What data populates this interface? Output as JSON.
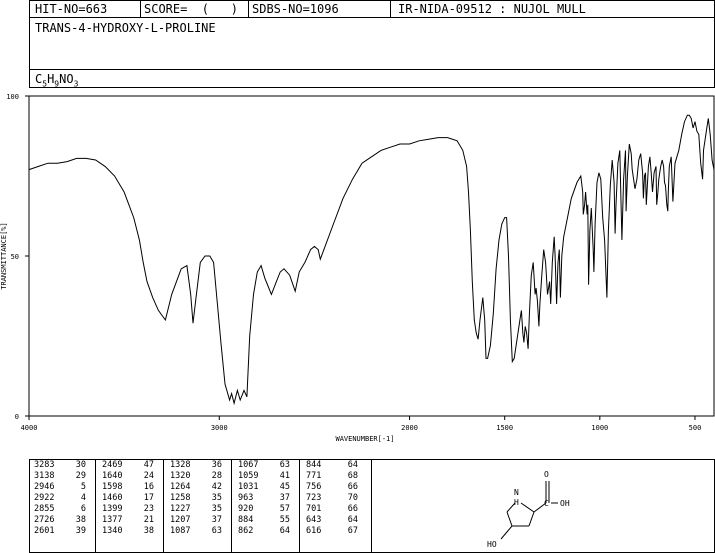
{
  "header": {
    "hit_no": "HIT-NO=663",
    "score": "SCORE=  (   )",
    "sdbs_no": "SDBS-NO=1096",
    "ir_info": "IR-NIDA-09512 : NUJOL MULL",
    "compound_name": "TRANS-4-HYDROXY-L-PROLINE",
    "formula_parts": [
      "C",
      "5",
      "H",
      "9",
      "N",
      "O",
      "3"
    ]
  },
  "chart_data": {
    "type": "line",
    "xlabel": "WAVENUMBER[-1]",
    "ylabel": "TRANSMITTANCE[%]",
    "xlim": [
      4000,
      400
    ],
    "ylim": [
      0,
      100
    ],
    "x_ticks": [
      4000,
      3000,
      2000,
      1500,
      1000,
      500
    ],
    "y_ticks": [
      0,
      50,
      100
    ],
    "x_tick_labels": [
      "4000",
      "3000",
      "2000",
      "1500",
      "1000",
      "500"
    ],
    "y_tick_labels": [
      "0",
      "50",
      "100"
    ],
    "series": [
      {
        "points": [
          [
            4000,
            77
          ],
          [
            3950,
            78
          ],
          [
            3900,
            79
          ],
          [
            3850,
            79
          ],
          [
            3800,
            79.5
          ],
          [
            3750,
            80.5
          ],
          [
            3700,
            80.5
          ],
          [
            3650,
            80
          ],
          [
            3600,
            78
          ],
          [
            3550,
            75
          ],
          [
            3500,
            70
          ],
          [
            3450,
            62
          ],
          [
            3420,
            55
          ],
          [
            3400,
            48
          ],
          [
            3380,
            42
          ],
          [
            3350,
            37
          ],
          [
            3320,
            33
          ],
          [
            3283,
            30
          ],
          [
            3250,
            38
          ],
          [
            3200,
            46
          ],
          [
            3170,
            47
          ],
          [
            3150,
            38
          ],
          [
            3138,
            29
          ],
          [
            3120,
            38
          ],
          [
            3100,
            48
          ],
          [
            3075,
            50
          ],
          [
            3050,
            50
          ],
          [
            3030,
            48
          ],
          [
            3010,
            35
          ],
          [
            2990,
            22
          ],
          [
            2970,
            10
          ],
          [
            2946,
            5
          ],
          [
            2935,
            7
          ],
          [
            2922,
            4
          ],
          [
            2905,
            8
          ],
          [
            2890,
            5
          ],
          [
            2870,
            8
          ],
          [
            2855,
            6
          ],
          [
            2840,
            25
          ],
          [
            2820,
            38
          ],
          [
            2800,
            45
          ],
          [
            2780,
            47
          ],
          [
            2760,
            43
          ],
          [
            2740,
            40
          ],
          [
            2726,
            38
          ],
          [
            2700,
            42
          ],
          [
            2680,
            45
          ],
          [
            2660,
            46
          ],
          [
            2630,
            44
          ],
          [
            2601,
            39
          ],
          [
            2580,
            45
          ],
          [
            2550,
            48
          ],
          [
            2520,
            52
          ],
          [
            2500,
            53
          ],
          [
            2480,
            52
          ],
          [
            2469,
            49
          ],
          [
            2450,
            52
          ],
          [
            2400,
            60
          ],
          [
            2350,
            68
          ],
          [
            2300,
            74
          ],
          [
            2250,
            79
          ],
          [
            2200,
            81
          ],
          [
            2150,
            83
          ],
          [
            2100,
            84
          ],
          [
            2050,
            85
          ],
          [
            2000,
            85
          ],
          [
            1950,
            86
          ],
          [
            1900,
            86.5
          ],
          [
            1850,
            87
          ],
          [
            1800,
            87
          ],
          [
            1750,
            86
          ],
          [
            1720,
            83
          ],
          [
            1700,
            78
          ],
          [
            1690,
            70
          ],
          [
            1680,
            58
          ],
          [
            1670,
            42
          ],
          [
            1660,
            30
          ],
          [
            1650,
            26
          ],
          [
            1640,
            24
          ],
          [
            1630,
            30
          ],
          [
            1615,
            37
          ],
          [
            1605,
            30
          ],
          [
            1598,
            18
          ],
          [
            1590,
            18
          ],
          [
            1575,
            22
          ],
          [
            1560,
            32
          ],
          [
            1545,
            46
          ],
          [
            1530,
            55
          ],
          [
            1515,
            60
          ],
          [
            1500,
            62
          ],
          [
            1490,
            62
          ],
          [
            1480,
            50
          ],
          [
            1470,
            30
          ],
          [
            1460,
            17
          ],
          [
            1450,
            18
          ],
          [
            1440,
            22
          ],
          [
            1420,
            30
          ],
          [
            1412,
            33
          ],
          [
            1405,
            26
          ],
          [
            1399,
            23
          ],
          [
            1392,
            28
          ],
          [
            1385,
            26
          ],
          [
            1377,
            21
          ],
          [
            1370,
            32
          ],
          [
            1360,
            44
          ],
          [
            1350,
            48
          ],
          [
            1340,
            38
          ],
          [
            1335,
            40
          ],
          [
            1328,
            36
          ],
          [
            1320,
            28
          ],
          [
            1315,
            35
          ],
          [
            1305,
            44
          ],
          [
            1295,
            52
          ],
          [
            1285,
            48
          ],
          [
            1275,
            38
          ],
          [
            1264,
            42
          ],
          [
            1258,
            35
          ],
          [
            1250,
            48
          ],
          [
            1240,
            56
          ],
          [
            1235,
            50
          ],
          [
            1227,
            35
          ],
          [
            1220,
            48
          ],
          [
            1213,
            52
          ],
          [
            1207,
            37
          ],
          [
            1200,
            50
          ],
          [
            1190,
            56
          ],
          [
            1170,
            62
          ],
          [
            1150,
            68
          ],
          [
            1120,
            73
          ],
          [
            1100,
            75
          ],
          [
            1090,
            70
          ],
          [
            1087,
            63
          ],
          [
            1080,
            66
          ],
          [
            1075,
            70
          ],
          [
            1067,
            63
          ],
          [
            1063,
            66
          ],
          [
            1059,
            41
          ],
          [
            1052,
            58
          ],
          [
            1045,
            65
          ],
          [
            1035,
            52
          ],
          [
            1031,
            45
          ],
          [
            1025,
            60
          ],
          [
            1015,
            73
          ],
          [
            1005,
            76
          ],
          [
            995,
            74
          ],
          [
            985,
            62
          ],
          [
            975,
            55
          ],
          [
            963,
            37
          ],
          [
            955,
            58
          ],
          [
            945,
            72
          ],
          [
            935,
            80
          ],
          [
            925,
            73
          ],
          [
            920,
            57
          ],
          [
            915,
            66
          ],
          [
            905,
            79
          ],
          [
            895,
            83
          ],
          [
            884,
            55
          ],
          [
            875,
            74
          ],
          [
            865,
            83
          ],
          [
            862,
            64
          ],
          [
            855,
            75
          ],
          [
            845,
            85
          ],
          [
            835,
            82
          ],
          [
            830,
            77
          ],
          [
            815,
            71
          ],
          [
            805,
            74
          ],
          [
            795,
            80
          ],
          [
            785,
            82
          ],
          [
            775,
            76
          ],
          [
            771,
            68
          ],
          [
            765,
            75
          ],
          [
            760,
            76
          ],
          [
            756,
            66
          ],
          [
            745,
            78
          ],
          [
            737,
            81
          ],
          [
            730,
            76
          ],
          [
            723,
            70
          ],
          [
            715,
            76
          ],
          [
            705,
            78
          ],
          [
            701,
            66
          ],
          [
            695,
            70
          ],
          [
            690,
            74
          ],
          [
            680,
            78
          ],
          [
            672,
            80
          ],
          [
            665,
            78
          ],
          [
            660,
            73
          ],
          [
            655,
            72
          ],
          [
            648,
            66
          ],
          [
            643,
            64
          ],
          [
            640,
            70
          ],
          [
            635,
            78
          ],
          [
            625,
            81
          ],
          [
            616,
            67
          ],
          [
            605,
            79
          ],
          [
            595,
            81
          ],
          [
            585,
            83
          ],
          [
            570,
            88
          ],
          [
            555,
            92
          ],
          [
            540,
            94
          ],
          [
            530,
            94
          ],
          [
            520,
            93
          ],
          [
            510,
            90
          ],
          [
            500,
            92
          ],
          [
            490,
            89
          ],
          [
            480,
            88
          ],
          [
            470,
            79
          ],
          [
            460,
            74
          ],
          [
            455,
            83
          ],
          [
            445,
            87
          ],
          [
            438,
            90
          ],
          [
            430,
            93
          ],
          [
            420,
            88
          ],
          [
            410,
            80
          ],
          [
            400,
            77
          ]
        ]
      }
    ]
  },
  "peak_table": {
    "columns": [
      [
        [
          "3283",
          "30"
        ],
        [
          "3138",
          "29"
        ],
        [
          "2946",
          "5"
        ],
        [
          "2922",
          "4"
        ],
        [
          "2855",
          "6"
        ],
        [
          "2726",
          "38"
        ],
        [
          "2601",
          "39"
        ]
      ],
      [
        [
          "2469",
          "47"
        ],
        [
          "1640",
          "24"
        ],
        [
          "1598",
          "16"
        ],
        [
          "1460",
          "17"
        ],
        [
          "1399",
          "23"
        ],
        [
          "1377",
          "21"
        ],
        [
          "1340",
          "38"
        ]
      ],
      [
        [
          "1328",
          "36"
        ],
        [
          "1320",
          "28"
        ],
        [
          "1264",
          "42"
        ],
        [
          "1258",
          "35"
        ],
        [
          "1227",
          "35"
        ],
        [
          "1207",
          "37"
        ],
        [
          "1087",
          "63"
        ]
      ],
      [
        [
          "1067",
          "63"
        ],
        [
          "1059",
          "41"
        ],
        [
          "1031",
          "45"
        ],
        [
          "963",
          "37"
        ],
        [
          "920",
          "57"
        ],
        [
          "884",
          "55"
        ],
        [
          "862",
          "64"
        ]
      ],
      [
        [
          "844",
          "64"
        ],
        [
          "771",
          "68"
        ],
        [
          "756",
          "66"
        ],
        [
          "723",
          "70"
        ],
        [
          "701",
          "66"
        ],
        [
          "643",
          "64"
        ],
        [
          "616",
          "67"
        ]
      ]
    ]
  },
  "structure": {
    "nh_label": "N",
    "h_label": "H",
    "oh_label": "OH",
    "o_label": "O",
    "c_label": "C",
    "ho_label": "HO"
  }
}
